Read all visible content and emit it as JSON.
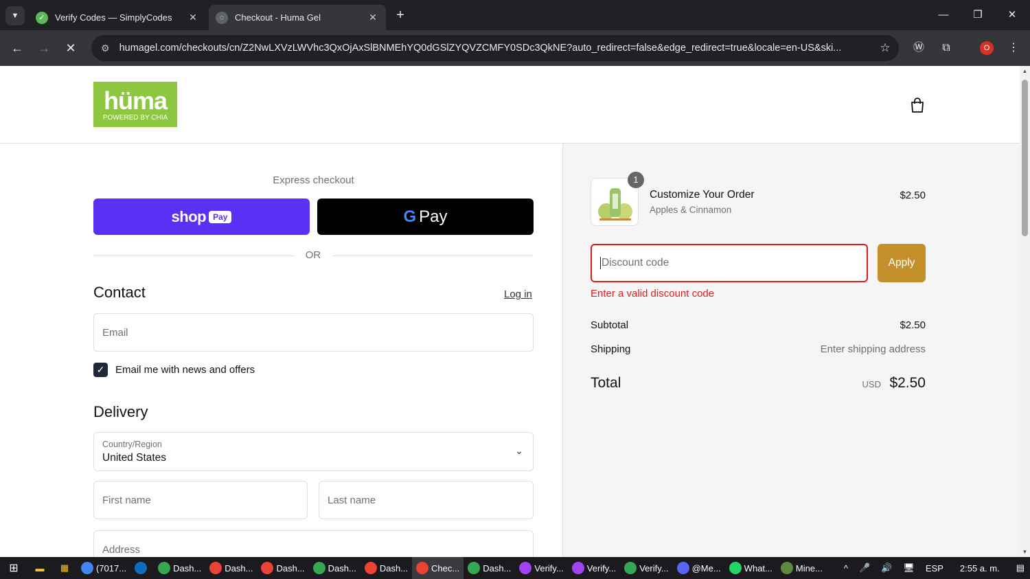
{
  "browser": {
    "tabs": [
      {
        "title": "Verify Codes — SimplyCodes",
        "active": false
      },
      {
        "title": "Checkout - Huma Gel",
        "active": true
      }
    ],
    "url": "humagel.com/checkouts/cn/Z2NwLXVzLWVhc3QxOjAxSlBNMEhYQ0dGSlZYQVZCMFY0SDc3QkNE?auto_redirect=false&edge_redirect=true&locale=en-US&ski...",
    "profile_badge": "O"
  },
  "header": {
    "logo_text": "hüma",
    "logo_sub": "POWERED BY CHIA"
  },
  "checkout": {
    "express_label": "Express checkout",
    "shoppay_word": "shop",
    "shoppay_pay": "Pay",
    "gpay_g": "G",
    "gpay_label": "Pay",
    "or_label": "OR",
    "contact_heading": "Contact",
    "login_link": "Log in",
    "email_placeholder": "Email",
    "newsletter_label": "Email me with news and offers",
    "newsletter_checked": true,
    "delivery_heading": "Delivery",
    "country_label": "Country/Region",
    "country_value": "United States",
    "first_name_placeholder": "First name",
    "last_name_placeholder": "Last name",
    "address_placeholder": "Address"
  },
  "order": {
    "item": {
      "name": "Customize Your Order",
      "variant": "Apples & Cinnamon",
      "price": "$2.50",
      "quantity": "1"
    },
    "discount_placeholder": "Discount code",
    "apply_label": "Apply",
    "discount_error": "Enter a valid discount code",
    "subtotal_label": "Subtotal",
    "subtotal_value": "$2.50",
    "shipping_label": "Shipping",
    "shipping_value": "Enter shipping address",
    "total_label": "Total",
    "total_currency": "USD",
    "total_value": "$2.50"
  },
  "taskbar": {
    "items": [
      {
        "label": "(7017...",
        "color": "#4285f4"
      },
      {
        "label": "",
        "color": "#0f6cbd"
      },
      {
        "label": "Dash...",
        "color": "#34a853"
      },
      {
        "label": "Dash...",
        "color": "#ea4335"
      },
      {
        "label": "Dash...",
        "color": "#ea4335"
      },
      {
        "label": "Dash...",
        "color": "#34a853"
      },
      {
        "label": "Dash...",
        "color": "#ea4335"
      },
      {
        "label": "Chec...",
        "color": "#ea4335"
      },
      {
        "label": "Dash...",
        "color": "#34a853"
      },
      {
        "label": "Verify...",
        "color": "#a142f4"
      },
      {
        "label": "Verify...",
        "color": "#a142f4"
      },
      {
        "label": "Verify...",
        "color": "#34a853"
      },
      {
        "label": "@Me...",
        "color": "#5865f2"
      },
      {
        "label": "What...",
        "color": "#25d366"
      },
      {
        "label": "Mine...",
        "color": "#5b8a3c"
      }
    ],
    "language": "ESP",
    "clock": "2:55 a. m."
  },
  "colors": {
    "shoppay": "#5a31f4",
    "apply": "#c3902b",
    "error": "#dd1d1d",
    "logo_green": "#8dc63f"
  }
}
